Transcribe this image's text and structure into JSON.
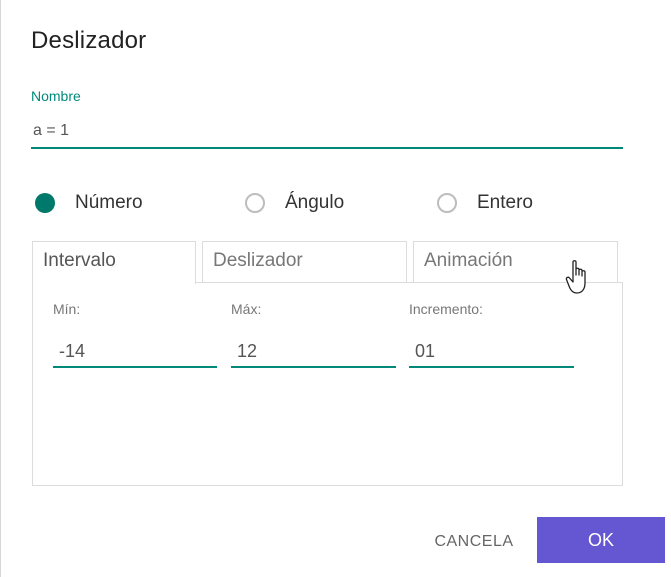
{
  "dialog": {
    "title": "Deslizador"
  },
  "name": {
    "label": "Nombre",
    "value": "a = 1"
  },
  "type_options": [
    {
      "label": "Número",
      "selected": true
    },
    {
      "label": "Ángulo",
      "selected": false
    },
    {
      "label": "Entero",
      "selected": false
    }
  ],
  "tabs": [
    {
      "label": "Intervalo",
      "active": true
    },
    {
      "label": "Deslizador",
      "active": false
    },
    {
      "label": "Animación",
      "active": false
    }
  ],
  "interval": {
    "min": {
      "label": "Mín:",
      "value": "-14"
    },
    "max": {
      "label": "Máx:",
      "value": "12"
    },
    "step": {
      "label": "Incremento:",
      "value": "01"
    }
  },
  "buttons": {
    "cancel": "CANCELA",
    "ok": "OK"
  },
  "colors": {
    "accent": "#00897b",
    "radio_selected": "#00796b",
    "ok_button": "#6557d2"
  },
  "icons": {
    "pointer": "hand-pointer-icon"
  }
}
